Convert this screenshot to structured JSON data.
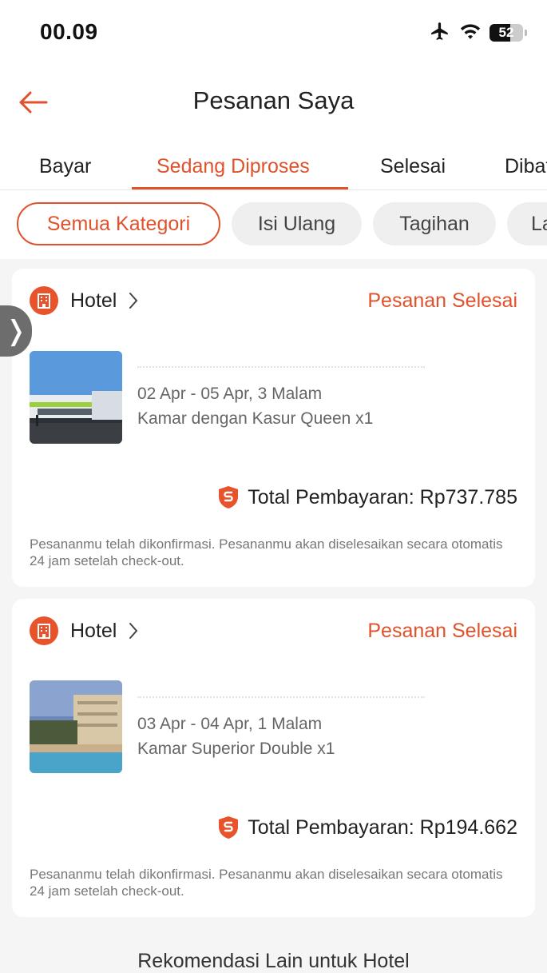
{
  "status_bar": {
    "time": "00.09",
    "battery": "52"
  },
  "header": {
    "title": "Pesanan Saya"
  },
  "tabs": [
    {
      "label": "Bayar"
    },
    {
      "label": "Sedang Diproses",
      "active": true
    },
    {
      "label": "Selesai"
    },
    {
      "label": "Dibatalkan"
    }
  ],
  "chips": [
    {
      "label": "Semua Kategori",
      "active": true
    },
    {
      "label": "Isi Ulang"
    },
    {
      "label": "Tagihan"
    },
    {
      "label": "Lainnya"
    }
  ],
  "side_handle": {
    "glyph": "❭"
  },
  "orders": [
    {
      "category": "Hotel",
      "status": "Pesanan Selesai",
      "dates": "02 Apr - 05 Apr, 3 Malam",
      "room": "Kamar dengan Kasur Queen x1",
      "total": "Total Pembayaran: Rp737.785",
      "note": "Pesananmu telah dikonfirmasi. Pesananmu akan diselesaikan secara otomatis 24 jam setelah check-out."
    },
    {
      "category": "Hotel",
      "status": "Pesanan Selesai",
      "dates": "03 Apr - 04 Apr, 1 Malam",
      "room": "Kamar Superior Double x1",
      "total": "Total Pembayaran: Rp194.662",
      "note": "Pesananmu telah dikonfirmasi. Pesananmu akan diselesaikan secara otomatis 24 jam setelah check-out."
    }
  ],
  "footer": {
    "text": "Rekomendasi Lain untuk Hotel"
  },
  "colors": {
    "accent": "#e0522c",
    "background": "#f5f5f5"
  }
}
